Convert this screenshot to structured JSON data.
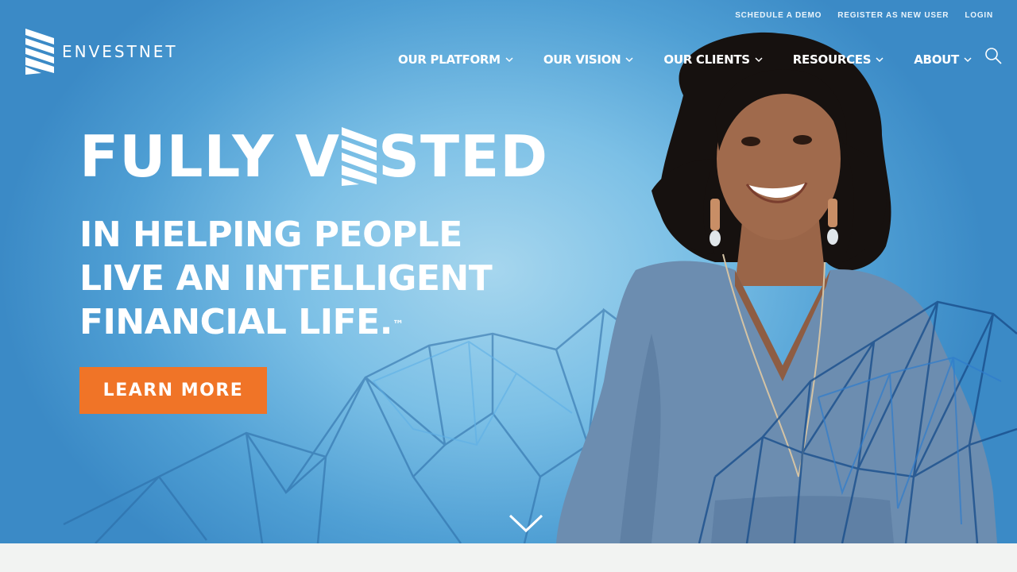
{
  "utility_nav": {
    "schedule_demo": "SCHEDULE A DEMO",
    "register": "REGISTER AS NEW USER",
    "login": "LOGIN"
  },
  "logo": {
    "text": "ENVESTNET"
  },
  "nav": {
    "items": [
      {
        "label": "OUR PLATFORM"
      },
      {
        "label": "OUR VISION"
      },
      {
        "label": "OUR CLIENTS"
      },
      {
        "label": "RESOURCES"
      },
      {
        "label": "ABOUT"
      }
    ]
  },
  "hero": {
    "headline_part1": "FULLY V",
    "headline_part2": "STED",
    "sub_line1": "IN HELPING PEOPLE",
    "sub_line2": "LIVE AN INTELLIGENT",
    "sub_line3": "FINANCIAL LIFE.",
    "trademark": "™",
    "cta_label": "LEARN MORE"
  },
  "colors": {
    "accent_orange": "#f07427",
    "hero_blue": "#6cb6e4",
    "mesh_blue": "#1d5f9e"
  }
}
